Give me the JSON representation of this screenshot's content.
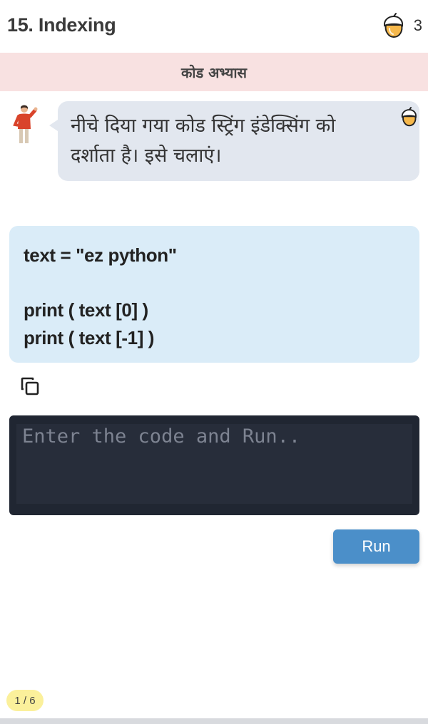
{
  "header": {
    "title": "15. Indexing",
    "acorn_count": "3",
    "acorn_icon": "acorn-icon"
  },
  "banner": {
    "text": "कोड अभ्यास"
  },
  "tutor": {
    "avatar_icon": "teacher-avatar-icon",
    "message": "नीचे दिया गया कोड स्ट्रिंग इंडेक्सिंग को दर्शाता है। इसे चलाएं।"
  },
  "code_example": {
    "lines": [
      "text = \"ez python\"",
      "",
      "print ( text [0] )",
      "print ( text [-1] )"
    ]
  },
  "editor": {
    "placeholder": "Enter the code and Run..",
    "value": ""
  },
  "actions": {
    "run_label": "Run"
  },
  "progress": {
    "page_label": "1 / 6"
  },
  "colors": {
    "banner_bg": "#f8e1e1",
    "code_bg": "#daecf8",
    "editor_bg": "#202632",
    "run_button": "#4b8fc9",
    "page_badge": "#fbf09b"
  }
}
